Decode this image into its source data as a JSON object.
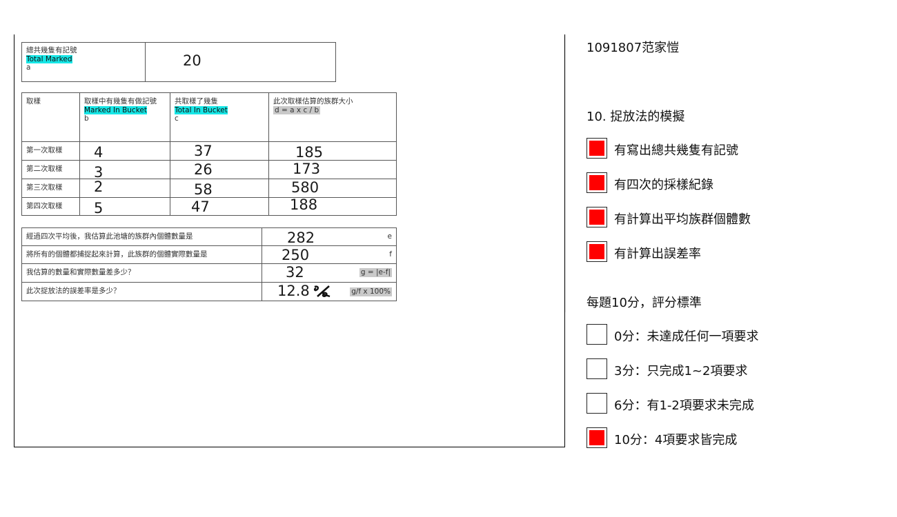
{
  "student": "1091807范家愷",
  "question_title": "10. 捉放法的模擬",
  "criteria": [
    {
      "label": "有寫出總共幾隻有記號",
      "checked": true
    },
    {
      "label": "有四次的採樣紀錄",
      "checked": true
    },
    {
      "label": "有計算出平均族群個體數",
      "checked": true
    },
    {
      "label": "有計算出誤差率",
      "checked": true
    }
  ],
  "scoring_title": "每題10分，評分標準",
  "scores": [
    {
      "label": "0分：未達成任何一項要求",
      "checked": false
    },
    {
      "label": "3分：只完成1~2項要求",
      "checked": false
    },
    {
      "label": "6分：有1-2項要求未完成",
      "checked": false
    },
    {
      "label": "10分：4項要求皆完成",
      "checked": true
    }
  ],
  "worksheet": {
    "total_marked": {
      "zh": "總共幾隻有記號",
      "en": "Total Marked",
      "var": "a",
      "value": "20"
    },
    "headers": {
      "sample": "取樣",
      "marked_zh": "取樣中有幾隻有做記號",
      "marked_en": "Marked In Bucket",
      "marked_var": "b",
      "total_zh": "共取樣了幾隻",
      "total_en": "Total In Bucket",
      "total_var": "c",
      "est_zh": "此次取樣估算的族群大小",
      "est_formula": "d = a x c / b"
    },
    "rows": [
      {
        "label": "第一次取樣",
        "b": "4",
        "c": "37",
        "d": "185"
      },
      {
        "label": "第二次取樣",
        "b": "3",
        "c": "26",
        "d": "173"
      },
      {
        "label": "第三次取樣",
        "b": "2",
        "c": "58",
        "d": "580"
      },
      {
        "label": "第四次取樣",
        "b": "5",
        "c": "47",
        "d": "188"
      }
    ],
    "summary": [
      {
        "q": "經過四次平均後，我估算此池塘的族群內個體數量是",
        "a": "282",
        "tag": "e"
      },
      {
        "q": "將所有的個體都捕捉起來計算，此族群的個體實際數量是",
        "a": "250",
        "tag": "f"
      },
      {
        "q": "我估算的數量和實際數量差多少？",
        "a": "32",
        "tag": "g = |e-f|"
      },
      {
        "q": "此次捉放法的誤差率是多少？",
        "a": "12.8",
        "tag": "g/f x 100%"
      }
    ]
  }
}
